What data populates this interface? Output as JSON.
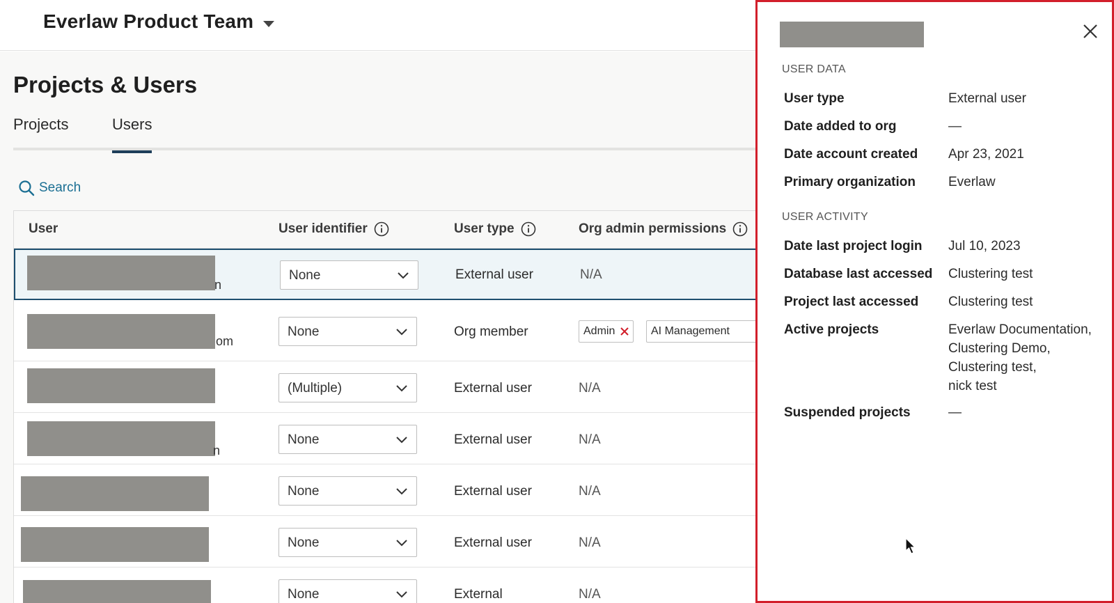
{
  "header": {
    "org_name": "Everlaw Product Team"
  },
  "page": {
    "title": "Projects & Users"
  },
  "tabs": [
    {
      "label": "Projects"
    },
    {
      "label": "Users"
    }
  ],
  "search": {
    "label": "Search"
  },
  "table": {
    "columns": [
      "User",
      "User identifier",
      "User type",
      "Org admin permissions"
    ],
    "rows": [
      {
        "user_tail": "n",
        "identifier": "None",
        "user_type": "External user",
        "permissions": "N/A"
      },
      {
        "user_tail": "om",
        "identifier": "None",
        "user_type": "Org member",
        "permissions_chips": [
          "Admin",
          "AI Management"
        ]
      },
      {
        "user_tail": "",
        "identifier": "(Multiple)",
        "user_type": "External user",
        "permissions": "N/A"
      },
      {
        "user_tail": "n",
        "identifier": "None",
        "user_type": "External user",
        "permissions": "N/A"
      },
      {
        "user_tail": "",
        "identifier": "None",
        "user_type": "External user",
        "permissions": "N/A"
      },
      {
        "user_tail": "",
        "identifier": "None",
        "user_type": "External user",
        "permissions": "N/A"
      },
      {
        "user_tail": "",
        "identifier": "None",
        "user_type": "External",
        "permissions": "N/A"
      }
    ]
  },
  "panel": {
    "user_data_title": "USER DATA",
    "user_data": [
      {
        "label": "User type",
        "value": "External user"
      },
      {
        "label": "Date added to org",
        "value": "—"
      },
      {
        "label": "Date account created",
        "value": "Apr 23, 2021"
      },
      {
        "label": "Primary organization",
        "value": "Everlaw"
      }
    ],
    "user_activity_title": "USER ACTIVITY",
    "user_activity": [
      {
        "label": "Date last project login",
        "value": "Jul 10, 2023"
      },
      {
        "label": "Database last accessed",
        "value": "Clustering test"
      },
      {
        "label": "Project last accessed",
        "value": "Clustering test"
      },
      {
        "label": "Active projects",
        "values": [
          "Everlaw Documentation,",
          "Clustering Demo,",
          "Clustering test,",
          "nick test"
        ]
      },
      {
        "label": "Suspended projects",
        "value": "—"
      }
    ]
  },
  "colors": {
    "accent": "#1e3f5a",
    "link": "#1b6f93",
    "panel_border": "#d21f2b",
    "chip_x": "#d21f2b",
    "redaction": "#908f8b"
  },
  "icons": [
    "chevron-down-icon",
    "search-icon",
    "info-icon",
    "close-icon",
    "remove-chip-icon",
    "mouse-cursor-icon"
  ]
}
